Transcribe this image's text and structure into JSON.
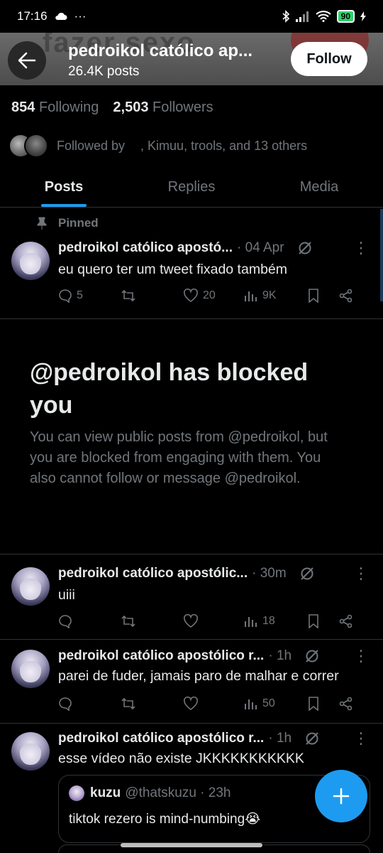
{
  "status_bar": {
    "time": "17:16",
    "dots": "···",
    "battery": "90"
  },
  "header": {
    "back_label": "back",
    "title": "pedroikol católico ap...",
    "subtitle": "26.4K posts",
    "follow_label": "Follow",
    "banner_text": "fazer sexo"
  },
  "profile": {
    "following_count": "854",
    "following_label": "Following",
    "followers_count": "2,503",
    "followers_label": "Followers",
    "followed_by_label": "Followed by",
    "followed_by_names": ", Kimuu, trools, and 13 others"
  },
  "tabs": [
    {
      "label": "Posts",
      "active": true
    },
    {
      "label": "Replies",
      "active": false
    },
    {
      "label": "Media",
      "active": false
    }
  ],
  "pinned_label": "Pinned",
  "posts": [
    {
      "name": "pedroikol católico apostó...",
      "time": "· 04 Apr",
      "text": "eu quero ter um tweet fixado também",
      "replies": "5",
      "reposts": "",
      "likes": "20",
      "views": "9K"
    },
    {
      "name": "pedroikol católico apostólic...",
      "time": "· 30m",
      "text": "uiii",
      "replies": "",
      "reposts": "",
      "likes": "",
      "views": "18"
    },
    {
      "name": "pedroikol católico apostólico r...",
      "time": "· 1h",
      "text": "parei de fuder, jamais paro de malhar e correr",
      "replies": "",
      "reposts": "",
      "likes": "",
      "views": "50"
    },
    {
      "name": "pedroikol católico apostólico r...",
      "time": "· 1h",
      "text": "esse vídeo não existe JKKKKKKKKKKK"
    }
  ],
  "blocked": {
    "title": "@pedroikol has blocked you",
    "body": "You can view public posts from @pedroikol, but you are blocked from engaging with them. You also cannot follow or message @pedroikol."
  },
  "quote": {
    "name": "kuzu",
    "handle": "@thatskuzu · 23h",
    "text": "tiktok rezero is mind-numbing😭"
  },
  "colors": {
    "accent": "#1d9bf0",
    "muted": "#71767b",
    "text": "#e7e9ea",
    "divider": "#2f3336"
  },
  "icons": [
    "back-arrow-icon",
    "pin-icon",
    "grok-icon",
    "more-icon",
    "reply-icon",
    "repost-icon",
    "like-icon",
    "views-icon",
    "bookmark-icon",
    "share-icon",
    "plus-icon"
  ]
}
